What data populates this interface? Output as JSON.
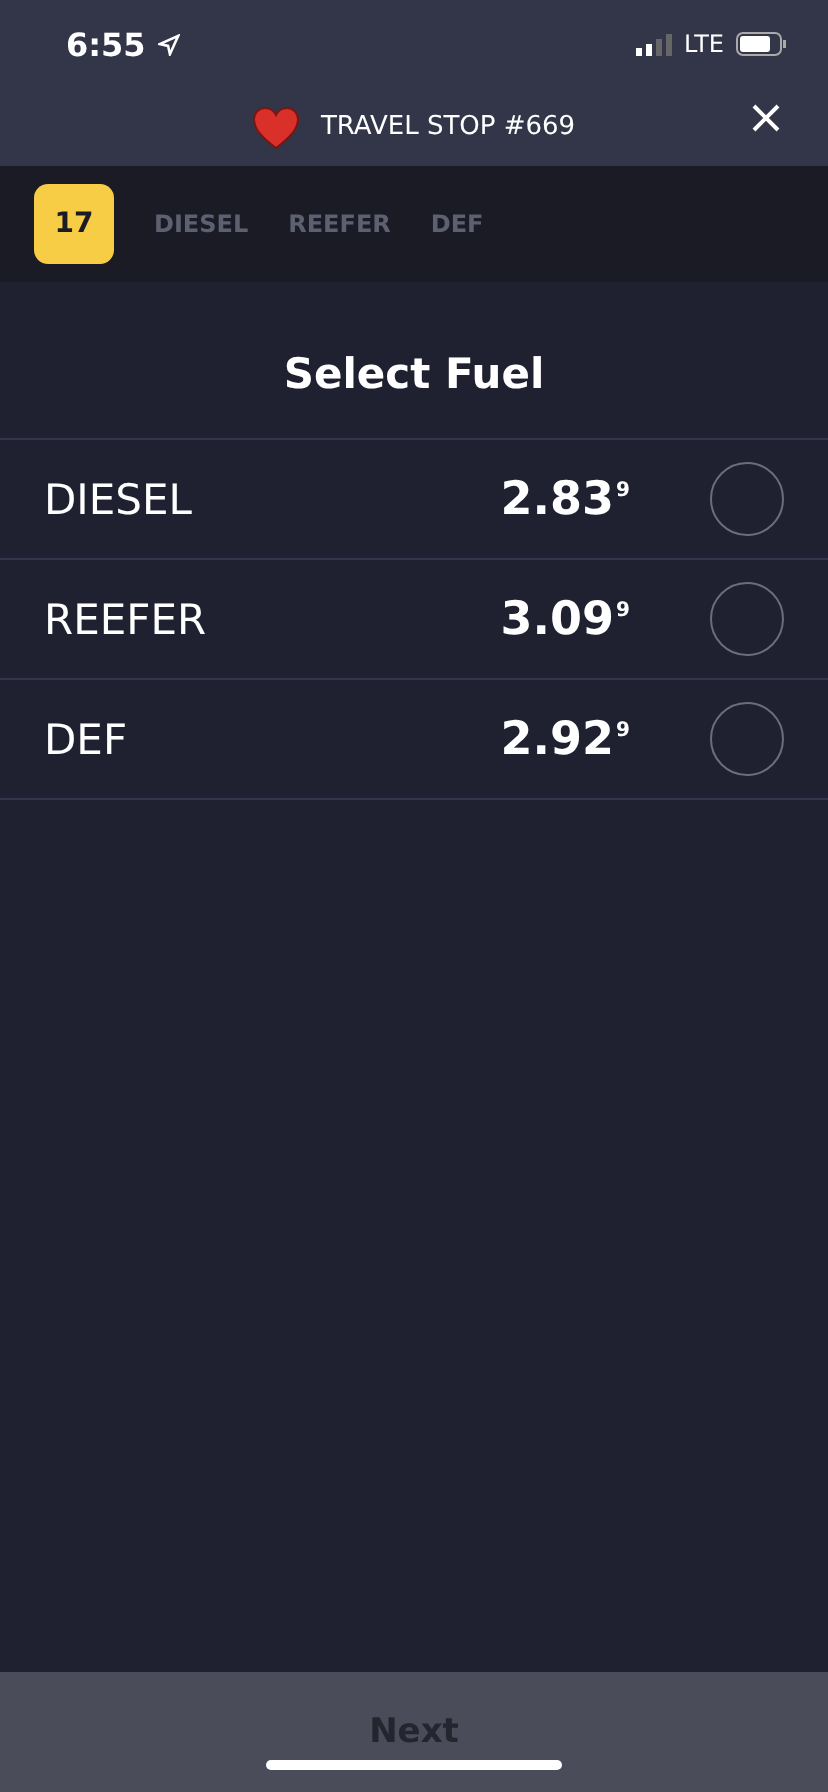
{
  "status_bar": {
    "time": "6:55",
    "network": "LTE"
  },
  "header": {
    "title": "TRAVEL STOP #669"
  },
  "steps": [
    {
      "label": "17",
      "kind": "badge",
      "selected": true
    },
    {
      "label": "DIESEL",
      "kind": "text",
      "selected": false
    },
    {
      "label": "REEFER",
      "kind": "text",
      "selected": false
    },
    {
      "label": "DEF",
      "kind": "text",
      "selected": false
    }
  ],
  "heading": "Select Fuel",
  "fuels": [
    {
      "name": "DIESEL",
      "price": "2.83$^{9}$",
      "selected": false
    },
    {
      "name": "REEFER",
      "price": "3.09$^{9}$",
      "selected": false
    },
    {
      "name": "DEF",
      "price": "2.92$^{9}$",
      "selected": false
    }
  ],
  "footer": {
    "button": "Next",
    "disabled": true
  }
}
